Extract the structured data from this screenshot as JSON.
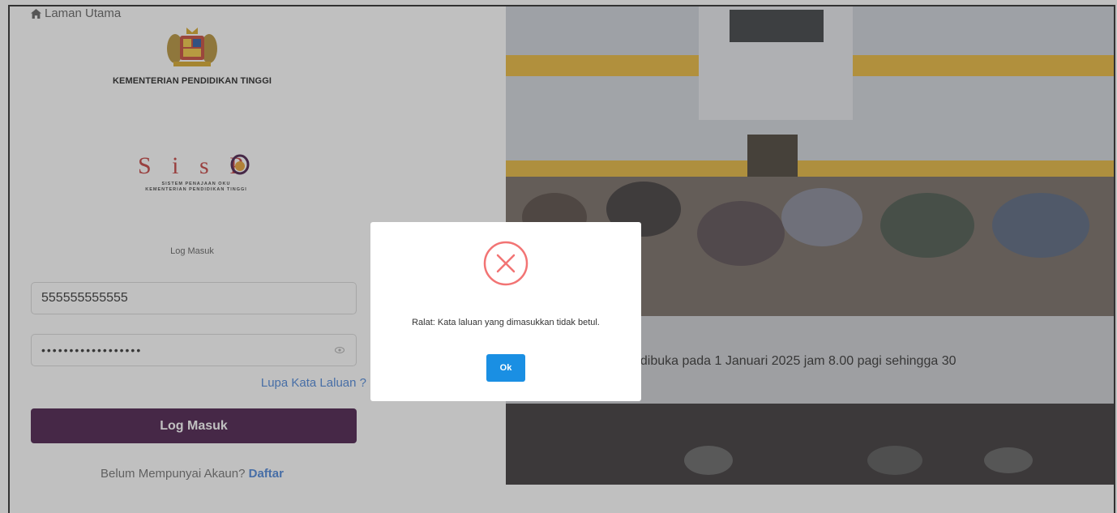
{
  "nav": {
    "home_label": "Laman Utama"
  },
  "header": {
    "ministry_name": "KEMENTERIAN PENDIDIKAN TINGGI"
  },
  "logo": {
    "letters": "S i s P",
    "sub_line1": "SISTEM PENAJAAN OKU",
    "sub_line2": "KEMENTERIAN PENDIDIKAN TINGGI"
  },
  "login": {
    "section_label": "Log Masuk",
    "ic_value": "555555555555",
    "password_mask": "••••••••••••••••••",
    "forgot_label": "Lupa Kata Laluan ?",
    "submit_label": "Log Masuk",
    "no_account_text": "Belum Mempunyai Akaun?",
    "signup_label": "Daftar"
  },
  "announcement": {
    "text": "OKU dan PPK akan dibuka pada 1 Januari 2025 jam 8.00 pagi sehingga 30\nm 5.00 petang."
  },
  "modal": {
    "message": "Ralat: Kata laluan yang dimasukkan tidak betul.",
    "ok_label": "Ok"
  },
  "colors": {
    "primary_button": "#3a0a3c",
    "link": "#3c7bd6",
    "ok_button": "#1a8fe3",
    "error_icon": "#f27474",
    "logo_red": "#c0312f"
  }
}
